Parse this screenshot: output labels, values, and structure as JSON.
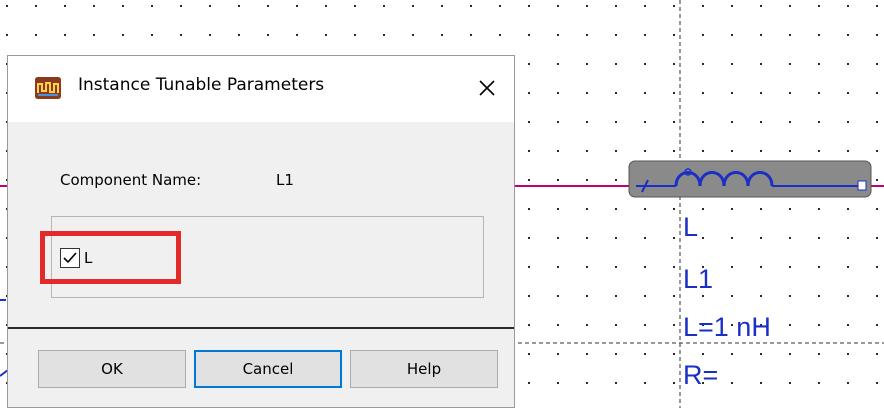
{
  "dialog": {
    "title": "Instance Tunable Parameters",
    "title_icon": "app-logo-icon",
    "close_icon": "close-icon",
    "component_name_label": "Component Name:",
    "component_name_value": "L1",
    "parameters": [
      {
        "label": "L",
        "checked": true
      }
    ],
    "buttons": {
      "ok": "OK",
      "cancel": "Cancel",
      "help": "Help"
    }
  },
  "schematic": {
    "component": {
      "type": "L",
      "name": "L1",
      "value": "L=1 nH",
      "r": "R="
    },
    "colors": {
      "wire": "#c0007a",
      "label": "#1a2fc4",
      "highlight": "#e22a2a"
    }
  }
}
